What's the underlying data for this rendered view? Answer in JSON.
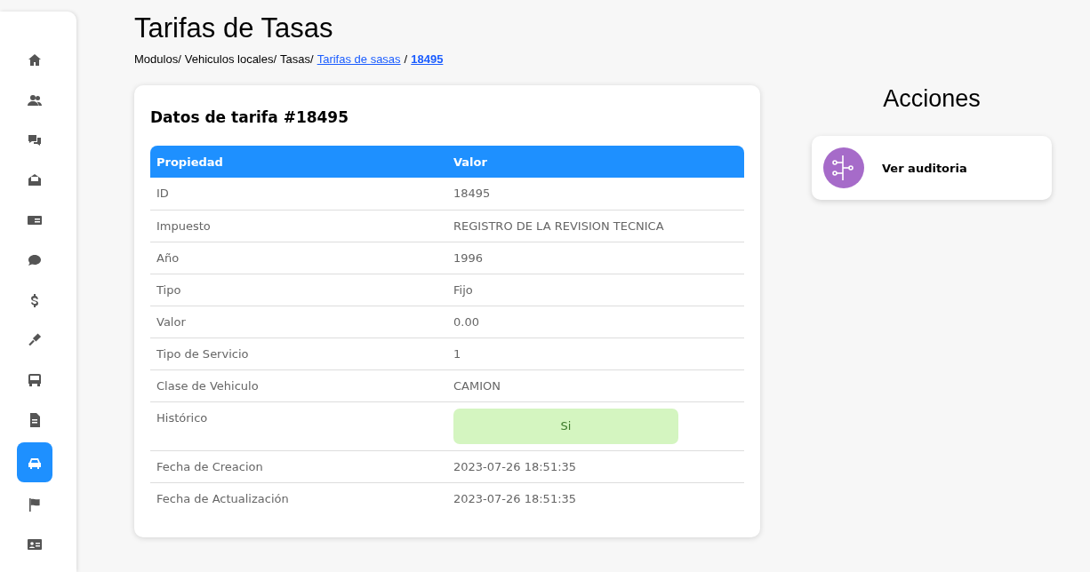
{
  "sidebar": {
    "items": [
      {
        "selected": false
      },
      {
        "selected": false
      },
      {
        "selected": false
      },
      {
        "selected": false
      },
      {
        "selected": false
      },
      {
        "selected": false
      },
      {
        "selected": false
      },
      {
        "selected": false
      },
      {
        "selected": false
      },
      {
        "selected": false
      },
      {
        "selected": true
      },
      {
        "selected": false
      },
      {
        "selected": false
      }
    ]
  },
  "page_title": "Tarifas de Tasas",
  "breadcrumb": [
    {
      "text": "Modulos/",
      "kind": "plain"
    },
    {
      "text": "Vehiculos locales/",
      "kind": "plain"
    },
    {
      "text": "Tasas/",
      "kind": "plain"
    },
    {
      "text": "Tarifas de sasas",
      "kind": "link"
    },
    {
      "text": "/",
      "kind": "plain"
    },
    {
      "text": "18495",
      "kind": "current"
    }
  ],
  "card": {
    "title": "Datos de tarifa #18495",
    "table": {
      "columns": [
        "Propiedad",
        "Valor"
      ],
      "rows": [
        {
          "property": "ID",
          "value": "18495",
          "kind": "text"
        },
        {
          "property": "Impuesto",
          "value": "REGISTRO DE LA REVISION TECNICA",
          "kind": "text"
        },
        {
          "property": "Año",
          "value": "1996",
          "kind": "text"
        },
        {
          "property": "Tipo",
          "value": "Fijo",
          "kind": "text"
        },
        {
          "property": "Valor",
          "value": "0.00",
          "kind": "text"
        },
        {
          "property": "Tipo de Servicio",
          "value": "1",
          "kind": "text"
        },
        {
          "property": "Clase de Vehiculo",
          "value": "CAMION",
          "kind": "text"
        },
        {
          "property": "Histórico",
          "value": "Si",
          "kind": "badge"
        },
        {
          "property": "Fecha de Creacion",
          "value": "2023-07-26 18:51:35",
          "kind": "text"
        },
        {
          "property": "Fecha de Actualización",
          "value": "2023-07-26 18:51:35",
          "kind": "text"
        }
      ]
    }
  },
  "actions": {
    "title": "Acciones",
    "items": [
      {
        "label": "Ver auditoria"
      }
    ]
  }
}
